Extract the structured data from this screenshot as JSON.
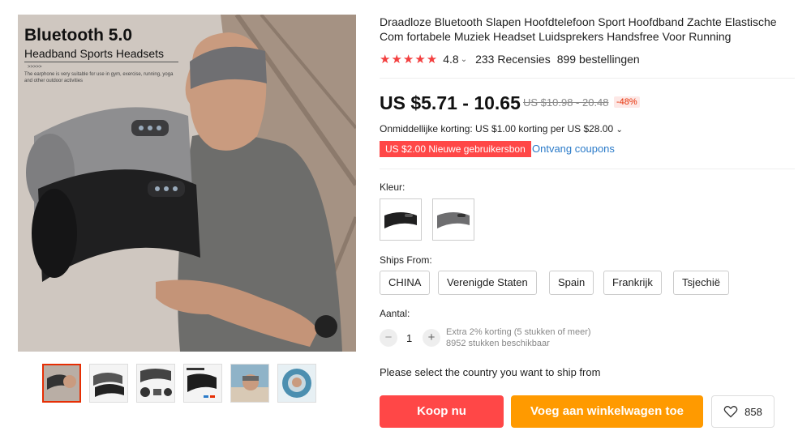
{
  "gallery": {
    "hero_title": "Bluetooth 5.0",
    "hero_subtitle": "Headband Sports Headsets",
    "hero_small": ">>>>>",
    "hero_desc": "The earphone is very suitable for use in gym, exercise, running, yoga and other outdoor activities",
    "thumbnails": [
      "thumb-1",
      "thumb-2",
      "thumb-3",
      "thumb-4",
      "thumb-5",
      "thumb-6"
    ]
  },
  "product": {
    "title": "Draadloze Bluetooth Slapen Hoofdtelefoon Sport Hoofdband Zachte Elastische Com fortabele Muziek Headset Luidsprekers Handsfree Voor Running",
    "stars": "★★★★★",
    "rating": "4.8",
    "reviews": "233 Recensies",
    "orders": "899 bestellingen",
    "price": "US $5.71 - 10.65",
    "old_price": "US $10.98 - 20.48",
    "discount": "-48%",
    "instant_discount": "Onmiddellijke korting: US $1.00 korting per US $28.00",
    "coupon": "US $2.00 Nieuwe gebruikersbon",
    "coupon_link": "Ontvang coupons"
  },
  "options": {
    "color_label": "Kleur:",
    "ships_from_label": "Ships From:",
    "ships_from": [
      "CHINA",
      "Verenigde Staten",
      "Spain",
      "Frankrijk",
      "Tsjechië"
    ],
    "quantity_label": "Aantal:",
    "quantity_minus": "−",
    "quantity_value": "1",
    "quantity_plus": "+",
    "quantity_note_1": "Extra 2% korting (5 stukken of meer)",
    "quantity_note_2": "8952 stukken beschikbaar",
    "ship_message": "Please select the country you want to ship from"
  },
  "actions": {
    "buy_now": "Koop nu",
    "add_to_cart": "Voeg aan winkelwagen toe",
    "wishlist_count": "858"
  },
  "colors": {
    "accent_red": "#ff4747",
    "accent_orange": "#ff9a00",
    "star": "#f33f3f",
    "link": "#2b7bc9"
  }
}
